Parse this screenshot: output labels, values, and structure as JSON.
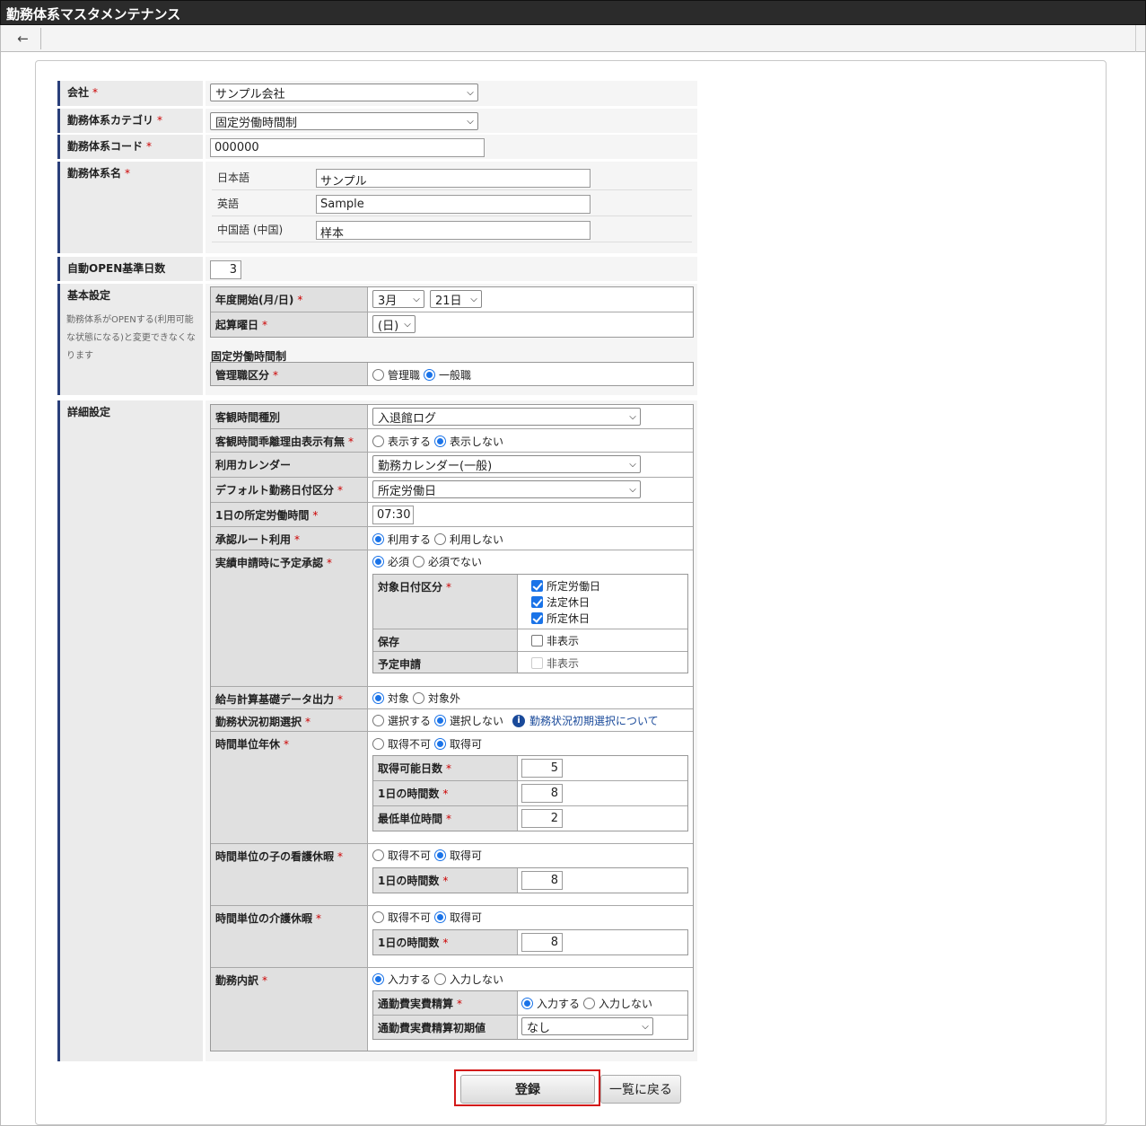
{
  "window": {
    "title": "勤務体系マスタメンテナンス"
  },
  "toolbar": {
    "back_icon": "←"
  },
  "required_mark": "*",
  "company": {
    "label": "会社",
    "value": "サンプル会社"
  },
  "category": {
    "label": "勤務体系カテゴリ",
    "value": "固定労働時間制"
  },
  "code": {
    "label": "勤務体系コード",
    "value": "000000"
  },
  "name": {
    "label": "勤務体系名",
    "rows": [
      {
        "lang": "日本語",
        "value": "サンプル"
      },
      {
        "lang": "英語",
        "value": "Sample"
      },
      {
        "lang": "中国語 (中国)",
        "value": "样本"
      }
    ]
  },
  "auto_open": {
    "label": "自動OPEN基準日数",
    "value": "3"
  },
  "basic": {
    "label": "基本設定",
    "note": "勤務体系がOPENする(利用可能な状態になる)と変更できなくなります",
    "fiscal_start": {
      "label": "年度開始(月/日)",
      "month": "3月",
      "day": "21日"
    },
    "start_weekday": {
      "label": "起算曜日",
      "value": "(日)"
    },
    "section_title": "固定労働時間制",
    "manager_type": {
      "label": "管理職区分",
      "options": [
        "管理職",
        "一般職"
      ],
      "selected": 1
    }
  },
  "detail": {
    "label": "詳細設定",
    "objective_time_type": {
      "label": "客観時間種別",
      "value": "入退館ログ"
    },
    "deviation_reason": {
      "label": "客観時間乖離理由表示有無",
      "options": [
        "表示する",
        "表示しない"
      ],
      "selected": 1
    },
    "calendar": {
      "label": "利用カレンダー",
      "value": "勤務カレンダー(一般)"
    },
    "default_date_type": {
      "label": "デフォルト勤務日付区分",
      "value": "所定労働日"
    },
    "daily_hours": {
      "label": "1日の所定労働時間",
      "value": "07:30"
    },
    "approval_route": {
      "label": "承認ルート利用",
      "options": [
        "利用する",
        "利用しない"
      ],
      "selected": 0
    },
    "plan_approval": {
      "label": "実績申請時に予定承認",
      "options": [
        "必須",
        "必須でない"
      ],
      "selected": 0,
      "target_date": {
        "label": "対象日付区分",
        "items": [
          "所定労働日",
          "法定休日",
          "所定休日"
        ]
      },
      "save": {
        "label": "保存",
        "option": "非表示"
      },
      "plan_request": {
        "label": "予定申請",
        "option": "非表示"
      }
    },
    "payroll_output": {
      "label": "給与計算基礎データ出力",
      "options": [
        "対象",
        "対象外"
      ],
      "selected": 0
    },
    "status_init": {
      "label": "勤務状況初期選択",
      "options": [
        "選択する",
        "選択しない"
      ],
      "selected": 1,
      "link": "勤務状況初期選択について",
      "info_icon": "i"
    },
    "hourly_leave": {
      "label": "時間単位年休",
      "options": [
        "取得不可",
        "取得可"
      ],
      "selected": 1,
      "days": {
        "label": "取得可能日数",
        "value": "5"
      },
      "hours_per_day": {
        "label": "1日の時間数",
        "value": "8"
      },
      "min_unit": {
        "label": "最低単位時間",
        "value": "2"
      }
    },
    "child_care": {
      "label": "時間単位の子の看護休暇",
      "options": [
        "取得不可",
        "取得可"
      ],
      "selected": 1,
      "hours_per_day": {
        "label": "1日の時間数",
        "value": "8"
      }
    },
    "nursing_care": {
      "label": "時間単位の介護休暇",
      "options": [
        "取得不可",
        "取得可"
      ],
      "selected": 1,
      "hours_per_day": {
        "label": "1日の時間数",
        "value": "8"
      }
    },
    "breakdown": {
      "label": "勤務内訳",
      "options": [
        "入力する",
        "入力しない"
      ],
      "selected": 0,
      "commute": {
        "label": "通勤費実費精算",
        "options": [
          "入力する",
          "入力しない"
        ],
        "selected": 0
      },
      "commute_default": {
        "label": "通勤費実費精算初期値",
        "value": "なし"
      }
    }
  },
  "actions": {
    "register": "登録",
    "back_to_list": "一覧に戻る"
  }
}
